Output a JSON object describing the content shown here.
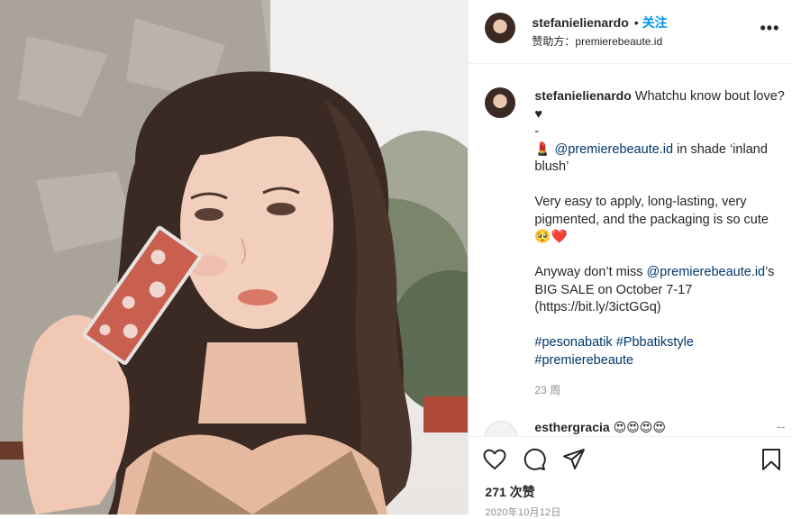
{
  "post": {
    "header": {
      "username": "stefanielienardo",
      "dot": "•",
      "follow_label": "关注",
      "sponsor_prefix": "赞助方：",
      "sponsor": "premierebeaute.id",
      "more_label": "•••"
    },
    "caption": {
      "username": "stefanielienardo",
      "line1": " Whatchu know bout love? ♥",
      "dash": "-",
      "lipstick_emoji": "💄",
      "mention1": "@premierebeaute.id",
      "shade_text": " in shade ‘inland blush’",
      "para2": "Very easy to apply, long-lasting, very pigmented, and the packaging is so cute 🥺❤️",
      "para3_pre": "Anyway don’t miss ",
      "mention2": "@premierebeaute.id",
      "para3_post": "’s BIG SALE on October 7-17 (https://bit.ly/3ictGGq)",
      "tag1": "#pesonabatik",
      "tag2": "#Pbbatikstyle",
      "tag3": "#premierebeaute",
      "time": "23 周"
    },
    "comment": {
      "username": "esthergracia",
      "text": "😍😍😍😍",
      "more": "--"
    },
    "actions": {
      "like_icon": "heart-icon",
      "comment_icon": "comment-icon",
      "share_icon": "paper-plane-icon",
      "save_icon": "bookmark-icon",
      "likes": "271 次赞",
      "date": "2020年10月12日"
    }
  }
}
